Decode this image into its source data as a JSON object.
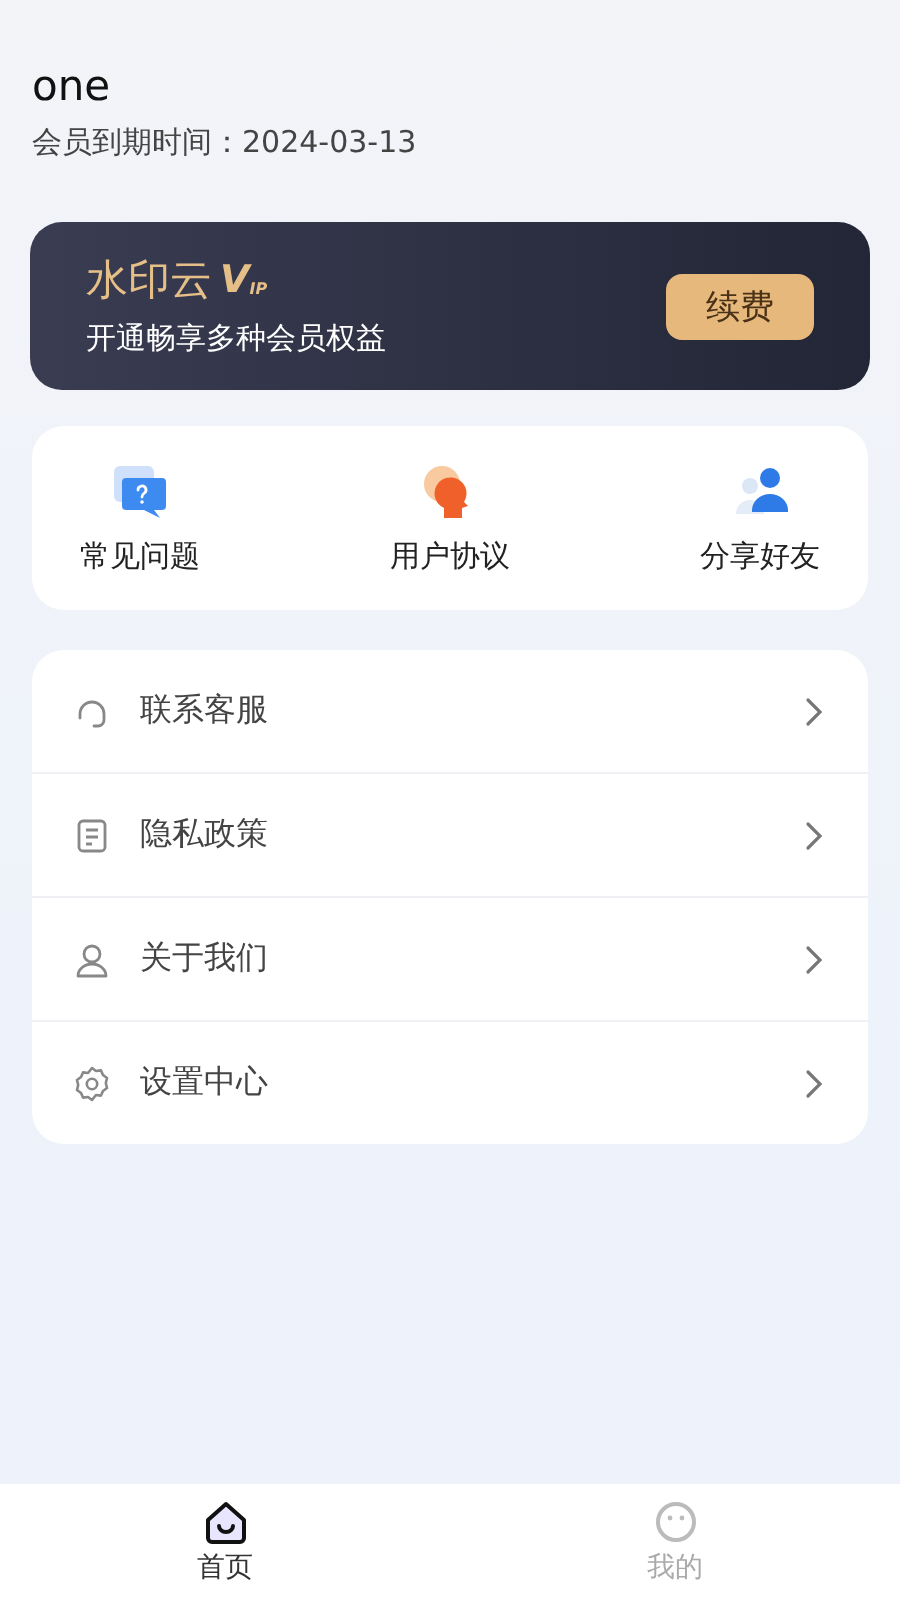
{
  "profile": {
    "name": "one",
    "expiry": "会员到期时间：2024-03-13"
  },
  "vip_card": {
    "brand": "水印云",
    "badge": "V",
    "badge_sub": "IP",
    "subtitle": "开通畅享多种会员权益",
    "button": "续费"
  },
  "quick_actions": [
    {
      "kind": "faq",
      "label": "常见问题"
    },
    {
      "kind": "agreement",
      "label": "用户协议"
    },
    {
      "kind": "share",
      "label": "分享好友"
    }
  ],
  "menu": [
    {
      "kind": "support",
      "label": "联系客服"
    },
    {
      "kind": "privacy",
      "label": "隐私政策"
    },
    {
      "kind": "about",
      "label": "关于我们"
    },
    {
      "kind": "settings",
      "label": "设置中心"
    }
  ],
  "tab_bar": [
    {
      "kind": "home",
      "label": "首页",
      "selected": true
    },
    {
      "kind": "mine",
      "label": "我的",
      "selected": false
    }
  ]
}
